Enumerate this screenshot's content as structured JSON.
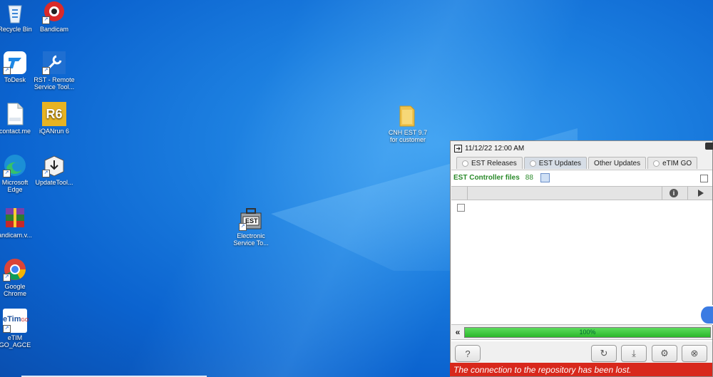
{
  "desktop": {
    "icons": [
      {
        "label": "Recycle Bin",
        "icon": "recycle-bin-icon"
      },
      {
        "label": "Bandicam",
        "icon": "bandicam-icon"
      },
      {
        "label": "ToDesk",
        "icon": "todesk-icon"
      },
      {
        "label": "RST - Remote Service Tool...",
        "icon": "rst-remote-service-tool-icon"
      },
      {
        "label": "contact.me",
        "icon": "document-icon"
      },
      {
        "label": "iQANrun 6",
        "icon": "iqanrun-icon"
      },
      {
        "label": "Microsoft Edge",
        "icon": "edge-icon"
      },
      {
        "label": "UpdateTool...",
        "icon": "update-tool-icon"
      },
      {
        "label": "andicam.v...",
        "icon": "winrar-archive-icon"
      },
      {
        "label": "Google Chrome",
        "icon": "chrome-icon"
      },
      {
        "label": "eTIM GO_AGCE",
        "icon": "etim-go-icon"
      },
      {
        "label": "Electronic Service To...",
        "icon": "est-toolbox-icon"
      },
      {
        "label": "CNH EST 9.7 for customer",
        "icon": "folder-icon"
      }
    ],
    "iqan_badge": "R6",
    "est_badge": "EST",
    "etim_badge_main": "eTim",
    "etim_badge_sub": "GO"
  },
  "window": {
    "datetime": "11/12/22 12:00 AM",
    "tabs": [
      {
        "label": "EST Releases",
        "active": false
      },
      {
        "label": "EST Updates",
        "active": true
      },
      {
        "label": "Other Updates",
        "active": false
      },
      {
        "label": "eTIM GO",
        "active": false
      }
    ],
    "files_label": "EST Controller files",
    "files_count": "88",
    "grid_info_glyph": "i",
    "progress_value": 1.0,
    "progress_text": "100%",
    "back_glyph": "«",
    "buttons": {
      "help": "?",
      "refresh": "↻",
      "download": "⤓",
      "settings": "⚙",
      "close": "⊗"
    },
    "status_message": "The connection to the repository has been lost."
  },
  "colors": {
    "status_bg": "#d8281c",
    "progress_fill": "#2ab72a",
    "files_label": "#2a8a2a"
  }
}
